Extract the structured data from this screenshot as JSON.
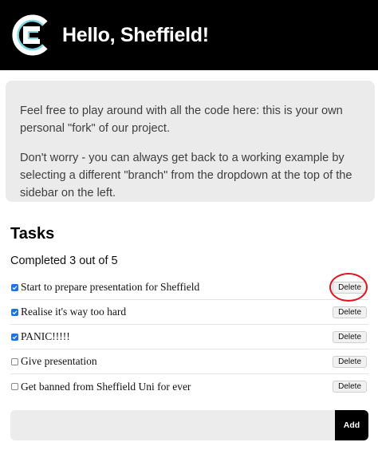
{
  "header": {
    "title": "Hello, Sheffield!",
    "logo_icon": "codesandbox-c-logo-icon"
  },
  "notice": {
    "paragraph_1": "Feel free to play around with all the code here: this is your own personal \"fork\" of our project.",
    "paragraph_2": "Don't worry - you can always get back to a working example by selecting a different \"branch\" from the dropdown at the top of the sidebar on the left."
  },
  "tasks": {
    "heading": "Tasks",
    "completed_text": "Completed 3 out of 5",
    "delete_label": "Delete",
    "items": [
      {
        "text": "Start to prepare presentation for Sheffield",
        "done": true
      },
      {
        "text": "Realise it's way too hard",
        "done": true
      },
      {
        "text": "PANIC!!!!!",
        "done": true
      },
      {
        "text": "Give presentation",
        "done": false
      },
      {
        "text": "Get banned from Sheffield Uni for ever",
        "done": false
      }
    ]
  },
  "add_form": {
    "input_value": "",
    "button_label": "Add"
  },
  "colors": {
    "header_bg": "#000000",
    "logo_accent": "#7fd6e6",
    "checkbox_checked": "#1a73e8",
    "highlight_ring": "#e0141f"
  }
}
